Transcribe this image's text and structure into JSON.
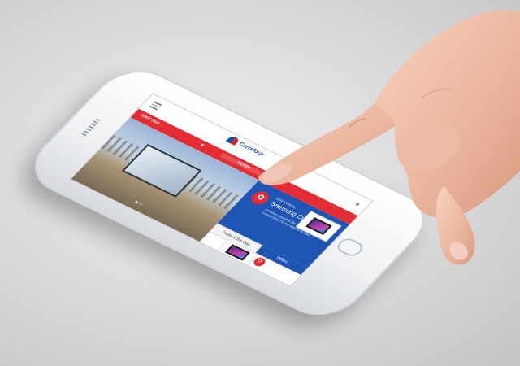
{
  "app": {
    "logo_text": "Carrefour",
    "nav_left_label": "Welcome",
    "nav_right_label": "Home"
  },
  "promo": {
    "pre_title": "NEW ARRIVAL",
    "title": "Samsung Curved UH...",
    "description": "Immerse yourself in the new world with the Curved UHD TV, the class of its own.",
    "badge_icon": "gift-icon"
  },
  "tabs": {
    "deals_label": "Deals of the Day",
    "offers_label": "Offers"
  },
  "icons": {
    "menu": "menu-icon",
    "user": "user-icon",
    "share": "share-icon"
  },
  "colors": {
    "brand_red": "#e42c35",
    "brand_blue": "#1f56b4"
  }
}
